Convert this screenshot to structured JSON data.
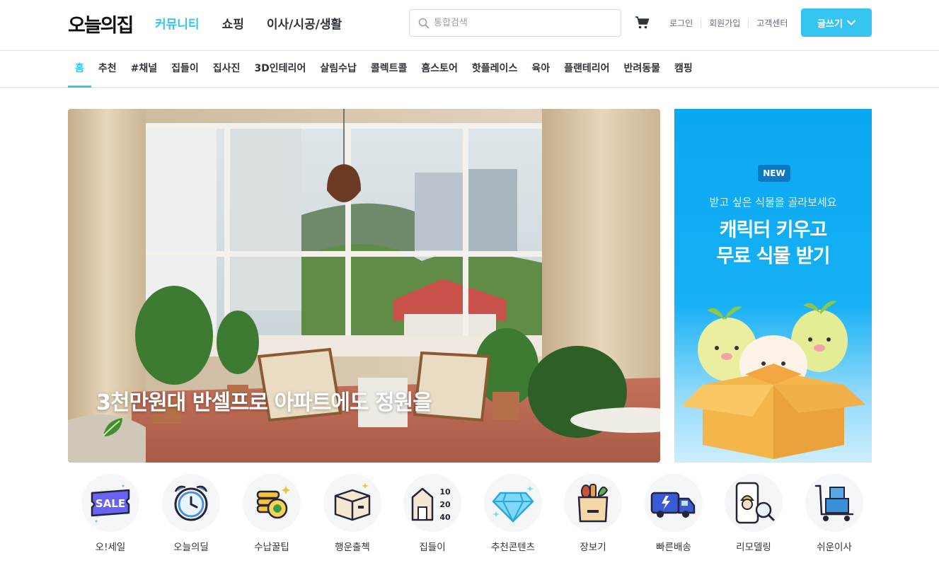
{
  "header": {
    "logo": "오늘의집",
    "nav": [
      {
        "label": "커뮤니티",
        "active": true
      },
      {
        "label": "쇼핑",
        "active": false
      },
      {
        "label": "이사/시공/생활",
        "active": false
      }
    ],
    "search_placeholder": "통합검색",
    "login": "로그인",
    "signup": "회원가입",
    "support": "고객센터",
    "write": "글쓰기"
  },
  "subnav": [
    "홈",
    "추천",
    "#채널",
    "집들이",
    "집사진",
    "3D인테리어",
    "살림수납",
    "콜렉트콜",
    "홈스토어",
    "핫플레이스",
    "육아",
    "플랜테리어",
    "반려동물",
    "캠핑"
  ],
  "hero": {
    "caption": "3천만원대 반셀프로 아파트에도 정원을"
  },
  "banner": {
    "badge": "NEW",
    "subtitle": "받고 싶은 식물을 골라보세요",
    "title_line1": "캐릭터 키우고",
    "title_line2": "무료 식물 받기"
  },
  "shortcuts": [
    {
      "label": "오!세일",
      "icon": "sale-ticket-icon",
      "icon_text": "SALE"
    },
    {
      "label": "오늘의딜",
      "icon": "alarm-clock-icon"
    },
    {
      "label": "수납꿀팁",
      "icon": "coin-stack-icon"
    },
    {
      "label": "행운출첵",
      "icon": "box-icon"
    },
    {
      "label": "집들이",
      "icon": "house-size-icon",
      "sizes": [
        "10",
        "20",
        "40"
      ]
    },
    {
      "label": "추천콘텐츠",
      "icon": "diamond-icon"
    },
    {
      "label": "장보기",
      "icon": "grocery-bag-icon"
    },
    {
      "label": "빠른배송",
      "icon": "delivery-truck-icon"
    },
    {
      "label": "리모델링",
      "icon": "remodeling-phone-icon"
    },
    {
      "label": "쉬운이사",
      "icon": "moving-cart-icon"
    }
  ],
  "colors": {
    "accent": "#35c5f0",
    "banner": "#0aa8f2"
  }
}
